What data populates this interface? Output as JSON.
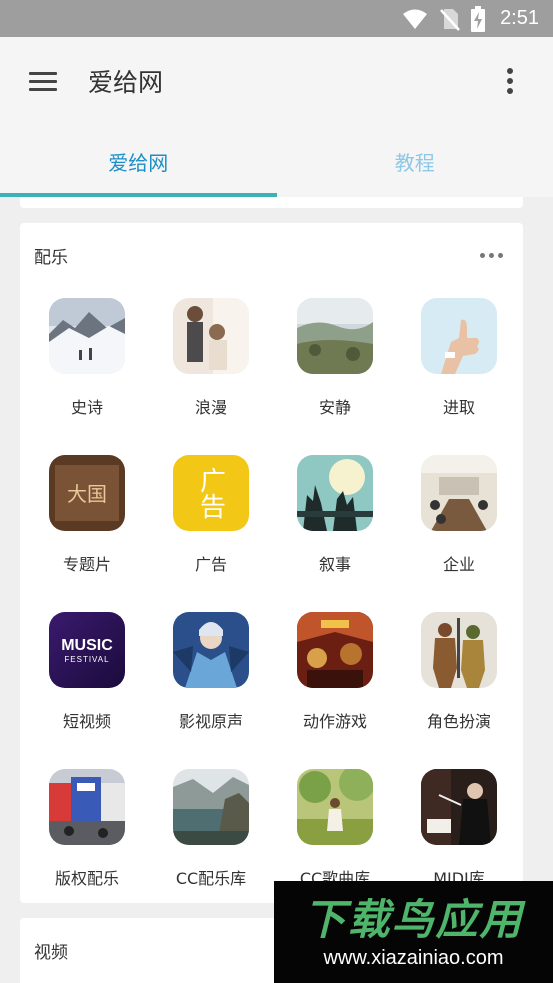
{
  "status_bar": {
    "time": "2:51"
  },
  "app_bar": {
    "title": "爱给网"
  },
  "tabs": [
    {
      "label": "爱给网",
      "active": true
    },
    {
      "label": "教程",
      "active": false
    }
  ],
  "music_section": {
    "title": "配乐",
    "items": [
      {
        "label": "史诗",
        "icon": "snow-mountain-thumbnail"
      },
      {
        "label": "浪漫",
        "icon": "couple-thumbnail"
      },
      {
        "label": "安静",
        "icon": "landscape-thumbnail"
      },
      {
        "label": "进取",
        "icon": "thumbs-up-thumbnail"
      },
      {
        "label": "专题片",
        "icon": "calligraphy-thumbnail"
      },
      {
        "label": "广告",
        "icon": "ad-thumbnail",
        "thumb_text": "广告"
      },
      {
        "label": "叙事",
        "icon": "hands-raised-thumbnail"
      },
      {
        "label": "企业",
        "icon": "meeting-room-thumbnail"
      },
      {
        "label": "短视频",
        "icon": "music-festival-thumbnail",
        "thumb_text": "MUSIC",
        "thumb_subtext": "FESTIVAL"
      },
      {
        "label": "影视原声",
        "icon": "fantasy-character-thumbnail"
      },
      {
        "label": "动作游戏",
        "icon": "game-poster-thumbnail"
      },
      {
        "label": "角色扮演",
        "icon": "warriors-thumbnail"
      },
      {
        "label": "版权配乐",
        "icon": "city-square-thumbnail"
      },
      {
        "label": "CC配乐库",
        "icon": "fjord-thumbnail"
      },
      {
        "label": "CC歌曲库",
        "icon": "girl-in-park-thumbnail"
      },
      {
        "label": "MIDI库",
        "icon": "conductor-thumbnail"
      }
    ]
  },
  "video_section": {
    "title": "视频"
  },
  "watermark": {
    "title": "下载鸟应用",
    "url": "www.xiazainiao.com"
  },
  "colors": {
    "accent": "#1c8fc7",
    "accent_light": "#8dc8e6",
    "indicator": "#3bb2b8",
    "watermark_green": "#4fb56b"
  }
}
